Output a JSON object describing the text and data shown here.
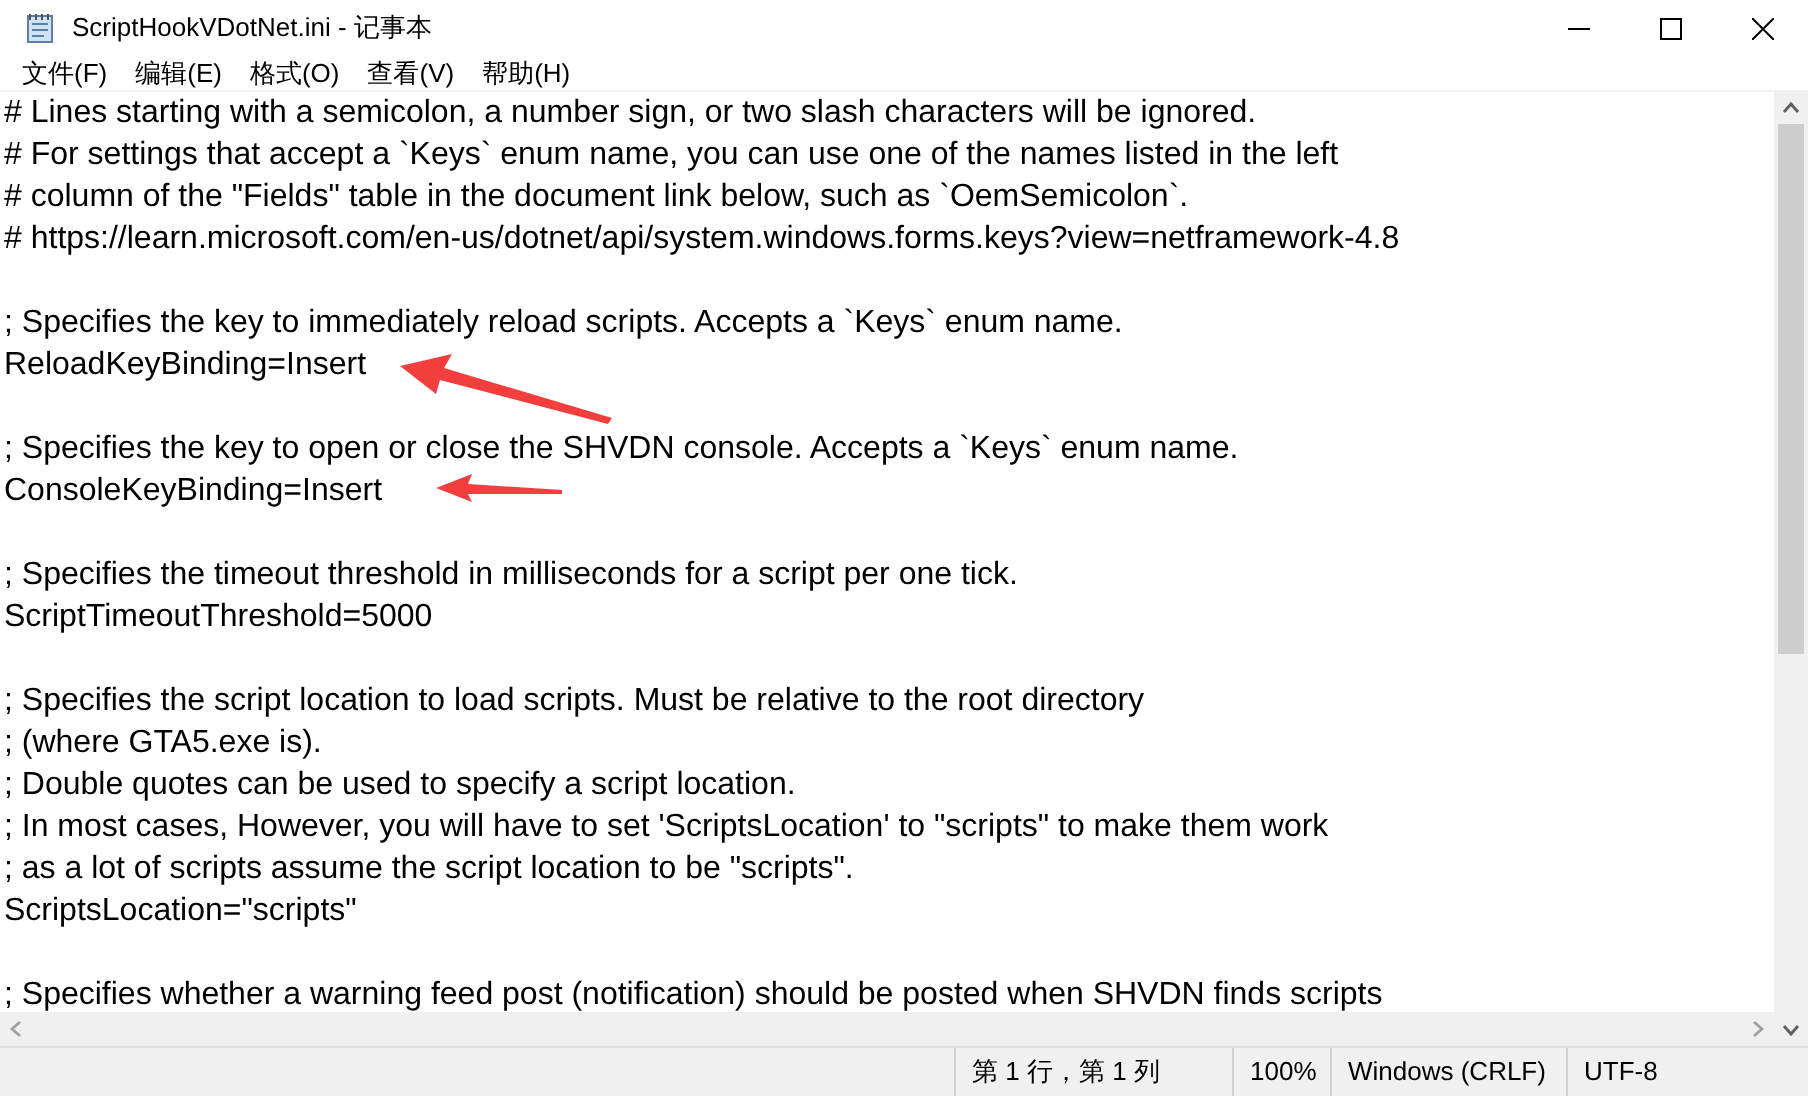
{
  "window": {
    "title": "ScriptHookVDotNet.ini - 记事本"
  },
  "menu": [
    "文件(F)",
    "编辑(E)",
    "格式(O)",
    "查看(V)",
    "帮助(H)"
  ],
  "editor": {
    "blocks": [
      [
        "# Lines starting with a semicolon, a number sign, or two slash characters will be ignored.",
        "# For settings that accept a `Keys` enum name, you can use one of the names listed in the left",
        "# column of the \"Fields\" table in the document link below, such as `OemSemicolon`.",
        "# https://learn.microsoft.com/en-us/dotnet/api/system.windows.forms.keys?view=netframework-4.8"
      ],
      [
        "; Specifies the key to immediately reload scripts. Accepts a `Keys` enum name.",
        "ReloadKeyBinding=Insert"
      ],
      [
        "; Specifies the key to open or close the SHVDN console. Accepts a `Keys` enum name.",
        "ConsoleKeyBinding=Insert"
      ],
      [
        "; Specifies the timeout threshold in milliseconds for a script per one tick.",
        "ScriptTimeoutThreshold=5000"
      ],
      [
        "; Specifies the script location to load scripts. Must be relative to the root directory",
        "; (where GTA5.exe is).",
        "; Double quotes can be used to specify a script location.",
        "; In most cases, However, you will have to set 'ScriptsLocation' to \"scripts\" to make them work",
        "; as a lot of scripts assume the script location to be \"scripts\".",
        "ScriptsLocation=\"scripts\""
      ],
      [
        "; Specifies whether a warning feed post (notification) should be posted when SHVDN finds scripts"
      ]
    ]
  },
  "status_bar": {
    "position": "第 1 行，第 1 列",
    "zoom": "100%",
    "line_ending": "Windows (CRLF)",
    "encoding": "UTF-8"
  }
}
